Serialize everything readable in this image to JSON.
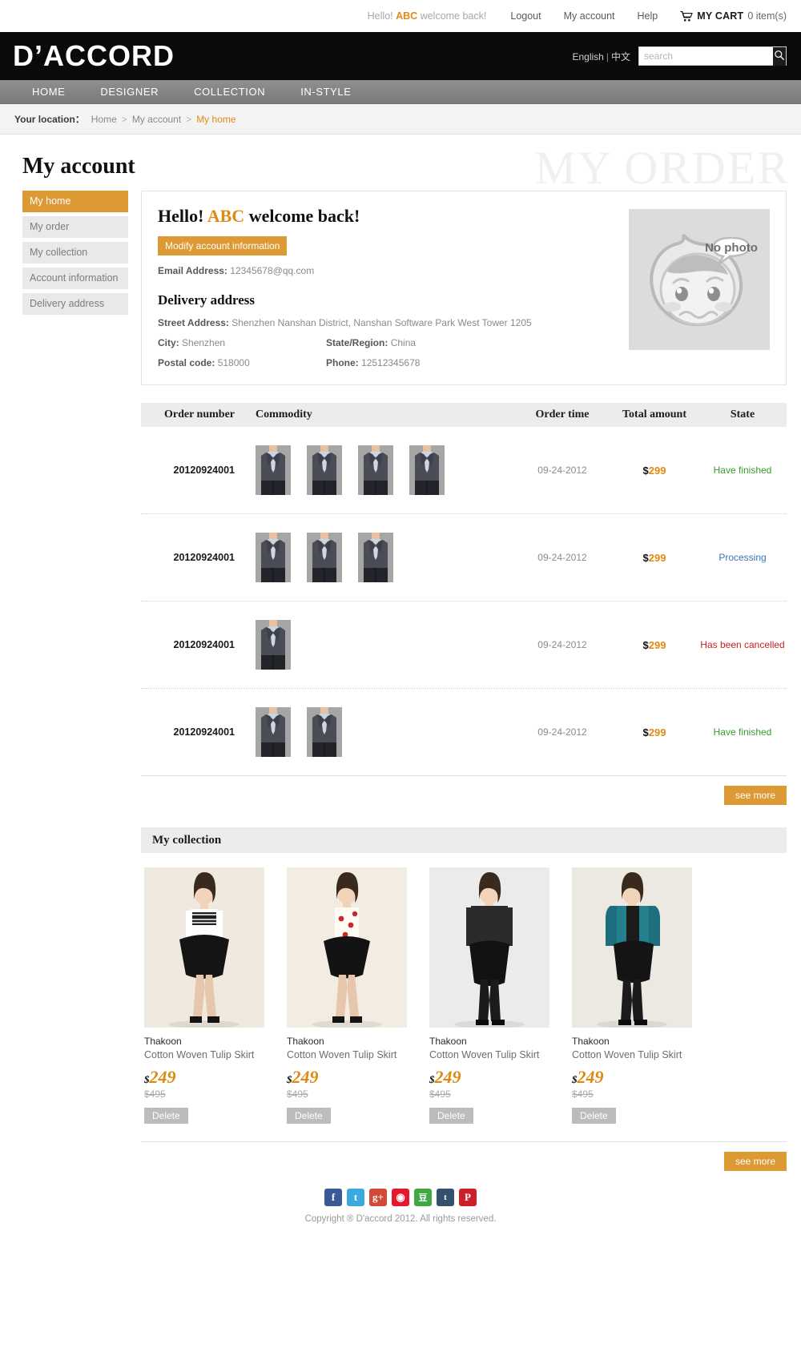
{
  "topbar": {
    "greeting_prefix": "Hello!",
    "username": "ABC",
    "greeting_suffix": "welcome back!",
    "logout": "Logout",
    "my_account": "My account",
    "help": "Help",
    "cart_label": "MY CART",
    "cart_count": "0 item(s)"
  },
  "header": {
    "logo": "D’ACCORD",
    "lang_en": "English",
    "lang_sep": "|",
    "lang_cn": "中文",
    "search_placeholder": "search",
    "search_value": ""
  },
  "nav": {
    "items": [
      {
        "label": "HOME"
      },
      {
        "label": "DESIGNER"
      },
      {
        "label": "COLLECTION"
      },
      {
        "label": "IN-STYLE"
      }
    ]
  },
  "breadcrumb": {
    "label": "Your location：",
    "home": "Home",
    "sep1": ">",
    "account": "My account",
    "sep2": ">",
    "current": "My home"
  },
  "page": {
    "title": "My account",
    "watermark": "MY ORDER"
  },
  "sidebar": {
    "items": [
      {
        "label": "My home",
        "active": true
      },
      {
        "label": "My order",
        "active": false
      },
      {
        "label": "My collection",
        "active": false
      },
      {
        "label": "Account information",
        "active": false
      },
      {
        "label": "Delivery address",
        "active": false
      }
    ]
  },
  "account": {
    "hello_prefix": "Hello!",
    "username": "ABC",
    "hello_suffix": "welcome back!",
    "modify_button": "Modify account information",
    "email_label": "Email Address:",
    "email_value": "12345678@qq.com",
    "delivery_title": "Delivery address",
    "street_label": "Street Address:",
    "street_value": "Shenzhen Nanshan District, Nanshan Software Park West Tower 1205",
    "city_label": "City:",
    "city_value": "Shenzhen",
    "state_label": "State/Region:",
    "state_value": "China",
    "postal_label": "Postal code:",
    "postal_value": "518000",
    "phone_label": "Phone:",
    "phone_value": "12512345678",
    "avatar_text": "No photo"
  },
  "orders": {
    "headers": {
      "number": "Order number",
      "commodity": "Commodity",
      "time": "Order time",
      "amount": "Total amount",
      "state": "State"
    },
    "rows": [
      {
        "number": "20120924001",
        "thumb_count": 4,
        "time": "09-24-2012",
        "currency": "$",
        "amount": "299",
        "state": "Have finished",
        "state_kind": "done"
      },
      {
        "number": "20120924001",
        "thumb_count": 3,
        "time": "09-24-2012",
        "currency": "$",
        "amount": "299",
        "state": "Processing",
        "state_kind": "proc"
      },
      {
        "number": "20120924001",
        "thumb_count": 1,
        "time": "09-24-2012",
        "currency": "$",
        "amount": "299",
        "state": "Has been cancelled",
        "state_kind": "cancel"
      },
      {
        "number": "20120924001",
        "thumb_count": 2,
        "time": "09-24-2012",
        "currency": "$",
        "amount": "299",
        "state": "Have finished",
        "state_kind": "done"
      }
    ],
    "see_more": "see more"
  },
  "collection": {
    "title": "My collection",
    "see_more": "see more",
    "items": [
      {
        "brand": "Thakoon",
        "name": "Cotton Woven Tulip Skirt",
        "currency": "$",
        "price": "249",
        "old_price": "$495",
        "delete": "Delete",
        "photo": "model-white-top-black-skirt"
      },
      {
        "brand": "Thakoon",
        "name": "Cotton Woven Tulip Skirt",
        "currency": "$",
        "price": "249",
        "old_price": "$495",
        "delete": "Delete",
        "photo": "model-cami-black-skirt"
      },
      {
        "brand": "Thakoon",
        "name": "Cotton Woven Tulip Skirt",
        "currency": "$",
        "price": "249",
        "old_price": "$495",
        "delete": "Delete",
        "photo": "model-all-black"
      },
      {
        "brand": "Thakoon",
        "name": "Cotton Woven Tulip Skirt",
        "currency": "$",
        "price": "249",
        "old_price": "$495",
        "delete": "Delete",
        "photo": "model-teal-jacket"
      }
    ]
  },
  "footer": {
    "socials": [
      {
        "name": "facebook-icon",
        "glyph": "f",
        "color": "#3b5998"
      },
      {
        "name": "twitter-icon",
        "glyph": "t",
        "color": "#3aa9e0"
      },
      {
        "name": "googleplus-icon",
        "glyph": "g+",
        "color": "#d34836"
      },
      {
        "name": "sina-weibo-icon",
        "glyph": "◉",
        "color": "#e6162d"
      },
      {
        "name": "douban-icon",
        "glyph": "豆",
        "color": "#40a944"
      },
      {
        "name": "tumblr-icon",
        "glyph": "t",
        "color": "#34526f"
      },
      {
        "name": "pinterest-icon",
        "glyph": "P",
        "color": "#cb2027"
      }
    ],
    "copyright": "Copyright ® D'accord 2012. All rights reserved."
  },
  "colors": {
    "accent": "#dd9933",
    "price": "#dd8b10",
    "state_done": "#3a9b2f",
    "state_processing": "#3a76b5",
    "state_cancelled": "#c82020"
  }
}
